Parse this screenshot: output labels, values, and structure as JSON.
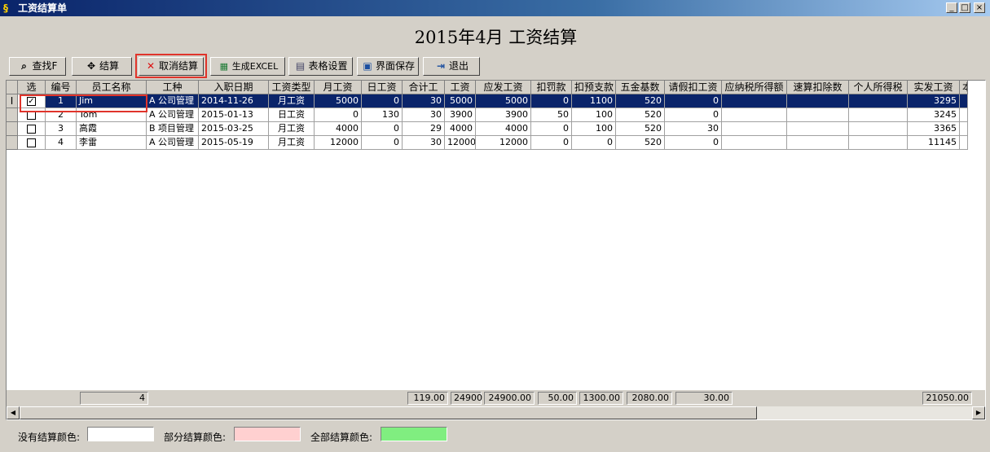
{
  "window": {
    "title": "工资结算单",
    "controls": [
      "_",
      "□",
      "×"
    ]
  },
  "banner": "2015年4月  工资结算",
  "toolbar": {
    "search_label": "查找F",
    "settle_label": "结算",
    "cancel_label": "取消结算",
    "excel_label": "生成EXCEL",
    "table_settings_label": "表格设置",
    "save_layout_label": "界面保存",
    "exit_label": "退出"
  },
  "grid": {
    "headers": [
      "选",
      "编号",
      "员工名称",
      "工种",
      "入职日期",
      "工资类型",
      "月工资",
      "日工资",
      "合计工",
      "工资",
      "应发工资",
      "扣罚款",
      "扣预支款",
      "五金基数",
      "请假扣工资",
      "应纳税所得额",
      "速算扣除数",
      "个人所得税",
      "实发工资",
      "本"
    ],
    "current_row_marker": "I",
    "rows": [
      {
        "checked": true,
        "id": "1",
        "name": "Jim",
        "job": "A 公司管理",
        "hire": "2014-11-26",
        "type": "月工资",
        "monthly": "5000",
        "daily": "0",
        "days": "30",
        "wage": "5000",
        "gross": "5000",
        "fine": "0",
        "advance": "1100",
        "base": "520",
        "leave": "0",
        "taxable": "",
        "quick": "",
        "tax": "",
        "net": "3295"
      },
      {
        "checked": false,
        "id": "2",
        "name": "Tom",
        "job": "A 公司管理",
        "hire": "2015-01-13",
        "type": "日工资",
        "monthly": "0",
        "daily": "130",
        "days": "30",
        "wage": "3900",
        "gross": "3900",
        "fine": "50",
        "advance": "100",
        "base": "520",
        "leave": "0",
        "taxable": "",
        "quick": "",
        "tax": "",
        "net": "3245"
      },
      {
        "checked": false,
        "id": "3",
        "name": "高霞",
        "job": "B 项目管理",
        "hire": "2015-03-25",
        "type": "月工资",
        "monthly": "4000",
        "daily": "0",
        "days": "29",
        "wage": "4000",
        "gross": "4000",
        "fine": "0",
        "advance": "100",
        "base": "520",
        "leave": "30",
        "taxable": "",
        "quick": "",
        "tax": "",
        "net": "3365"
      },
      {
        "checked": false,
        "id": "4",
        "name": "李雷",
        "job": "A 公司管理",
        "hire": "2015-05-19",
        "type": "月工资",
        "monthly": "12000",
        "daily": "0",
        "days": "30",
        "wage": "12000",
        "gross": "12000",
        "fine": "0",
        "advance": "0",
        "base": "520",
        "leave": "0",
        "taxable": "",
        "quick": "",
        "tax": "",
        "net": "11145"
      }
    ],
    "footer": {
      "count": "4",
      "days": "119.00",
      "wage": "24900",
      "gross": "24900.00",
      "fine": "50.00",
      "advance": "1300.00",
      "base": "2080.00",
      "leave": "30.00",
      "net": "21050.00"
    }
  },
  "legend": {
    "none_label": "没有结算颜色:",
    "none_color": "#ffffff",
    "partial_label": "部分结算颜色:",
    "partial_color": "#ffd0d0",
    "full_label": "全部结算颜色:",
    "full_color": "#80ee80"
  },
  "colors": {
    "highlight": "#e0342b",
    "selected_row": "#0a246a"
  }
}
